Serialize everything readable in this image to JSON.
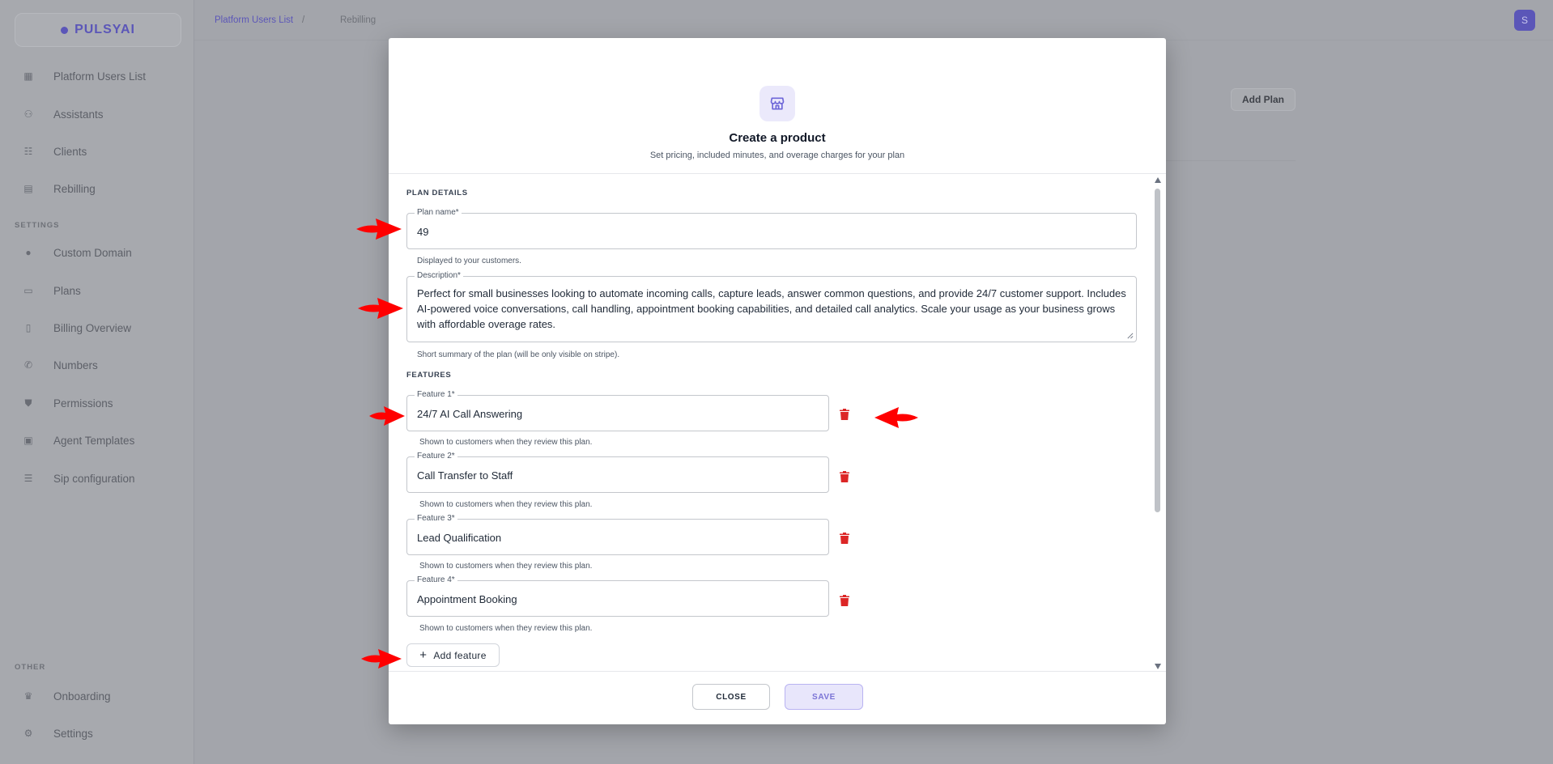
{
  "sidebar": {
    "brand": "PULSYAI",
    "items": [
      {
        "label": "Platform Users List",
        "icon": "grid-icon"
      },
      {
        "label": "Assistants",
        "icon": "user-plus-icon"
      },
      {
        "label": "Clients",
        "icon": "users-icon"
      },
      {
        "label": "Rebilling",
        "icon": "receipt-icon"
      }
    ],
    "settings_title": "SETTINGS",
    "settings_items": [
      {
        "label": "Custom Domain",
        "icon": "globe-icon"
      },
      {
        "label": "Plans",
        "icon": "card-icon"
      },
      {
        "label": "Billing Overview",
        "icon": "document-icon"
      },
      {
        "label": "Numbers",
        "icon": "phone-icon"
      },
      {
        "label": "Permissions",
        "icon": "shield-icon"
      },
      {
        "label": "Agent Templates",
        "icon": "template-icon"
      },
      {
        "label": "Sip configuration",
        "icon": "server-icon"
      }
    ],
    "other_title": "OTHER",
    "other_items": [
      {
        "label": "Onboarding",
        "icon": "trophy-icon"
      },
      {
        "label": "Settings",
        "icon": "gear-icon"
      }
    ]
  },
  "topbar": {
    "breadcrumb": [
      "Platform Users List",
      "/",
      "Rebilling"
    ],
    "avatar_initial": "S"
  },
  "page": {
    "add_plan_label": "Add Plan"
  },
  "modal": {
    "icon": "storefront-icon",
    "title": "Create a product",
    "subtitle": "Set pricing, included minutes, and overage charges for your plan",
    "plan_details_title": "PLAN DETAILS",
    "plan_name": {
      "label": "Plan name*",
      "value": "49",
      "helper": "Displayed to your customers."
    },
    "description": {
      "label": "Description*",
      "value": "Perfect for small businesses looking to automate incoming calls, capture leads, answer common questions, and provide 24/7 customer support. Includes AI-powered voice conversations, call handling, appointment booking capabilities, and detailed call analytics. Scale your usage as your business grows with affordable overage rates.",
      "helper": "Short summary of the plan (will be only visible on stripe)."
    },
    "features_title": "FEATURES",
    "features": [
      {
        "label": "Feature 1*",
        "value": "24/7 AI Call Answering",
        "helper": "Shown to customers when they review this plan."
      },
      {
        "label": "Feature 2*",
        "value": "Call Transfer to Staff",
        "helper": "Shown to customers when they review this plan."
      },
      {
        "label": "Feature 3*",
        "value": "Lead Qualification",
        "helper": "Shown to customers when they review this plan."
      },
      {
        "label": "Feature 4*",
        "value": "Appointment Booking",
        "helper": "Shown to customers when they review this plan."
      }
    ],
    "add_feature_label": "Add feature",
    "close_label": "CLOSE",
    "save_label": "SAVE"
  },
  "colors": {
    "accent": "#5b56b8",
    "danger": "#dc2626",
    "annotation_arrow": "#ff0000",
    "save_bg": "#e8e6fb"
  }
}
